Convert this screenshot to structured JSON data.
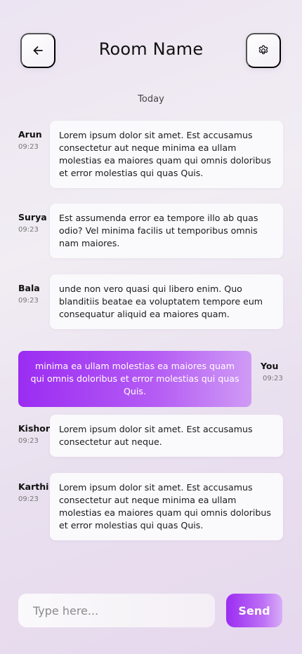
{
  "header": {
    "title": "Room Name",
    "back_icon": "arrow-left-icon",
    "settings_icon": "gear-icon"
  },
  "date_separator": "Today",
  "messages": [
    {
      "sender": "Arun",
      "time": "09:23",
      "text": "Lorem ipsum dolor sit amet. Est accusamus consectetur aut neque minima ea ullam molestias ea maiores quam qui omnis doloribus et error molestias qui quas Quis."
    },
    {
      "sender": "Surya",
      "time": "09:23",
      "text": "Est assumenda error ea tempore illo ab quas odio? Vel minima facilis ut temporibus omnis nam maiores."
    },
    {
      "sender": "Bala",
      "time": "09:23",
      "text": "unde non vero quasi qui libero enim. Quo blanditiis beatae ea voluptatem tempore eum consequatur aliquid ea maiores quam."
    },
    {
      "sender": "You",
      "time": "09:23",
      "text": "minima ea ullam molestias ea maiores quam qui omnis doloribus et error molestias qui quas Quis."
    },
    {
      "sender": "Kishor",
      "time": "09:23",
      "text": "Lorem ipsum dolor sit amet. Est accusamus consectetur aut neque."
    },
    {
      "sender": "Karthi",
      "time": "09:23",
      "text": "Lorem ipsum dolor sit amet. Est accusamus consectetur aut neque minima ea ullam molestias ea maiores quam qui omnis doloribus et error molestias qui quas Quis."
    }
  ],
  "composer": {
    "placeholder": "Type here...",
    "value": "",
    "send_label": "Send"
  },
  "colors": {
    "accent": "#9b2cf2",
    "accent_light": "#d7aef6",
    "bubble": "#faf9fb"
  }
}
